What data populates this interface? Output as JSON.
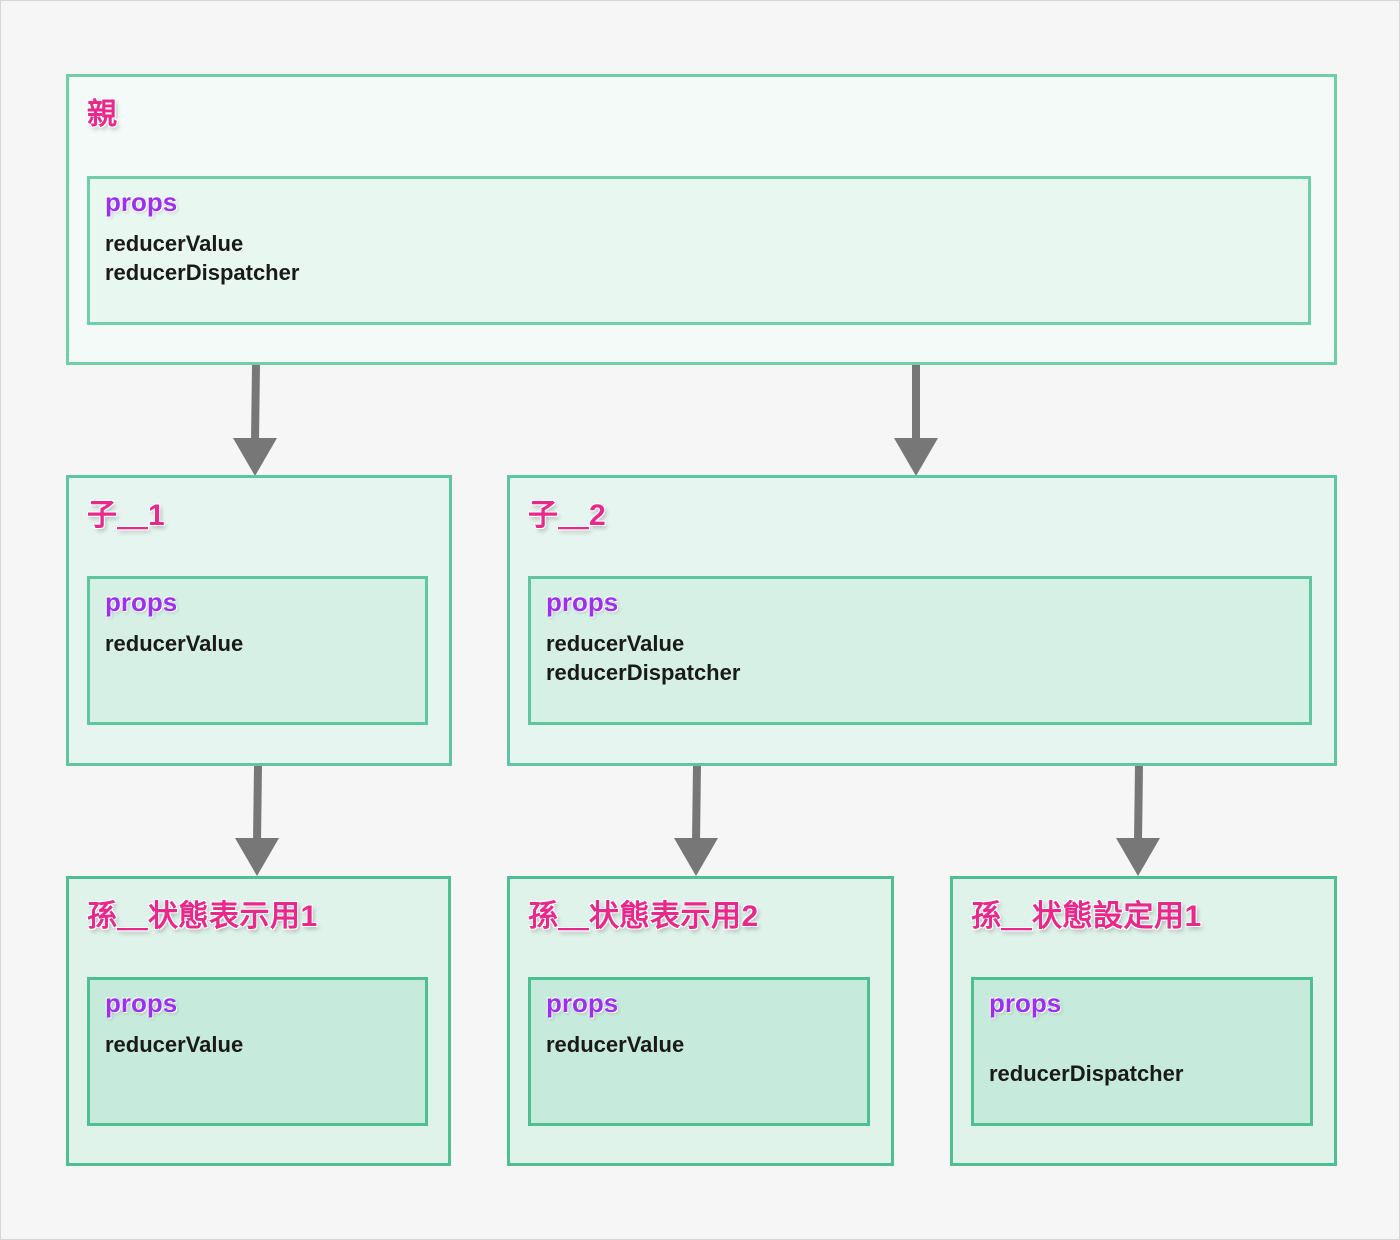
{
  "nodes": {
    "parent": {
      "title": "親",
      "props_label": "props",
      "values": [
        "reducerValue",
        "reducerDispatcher"
      ]
    },
    "child1": {
      "title": "子＿1",
      "props_label": "props",
      "values": [
        "reducerValue"
      ]
    },
    "child2": {
      "title": "子＿2",
      "props_label": "props",
      "values": [
        "reducerValue",
        "reducerDispatcher"
      ]
    },
    "grandchild_display1": {
      "title": "孫＿状態表示用1",
      "props_label": "props",
      "values": [
        "reducerValue"
      ]
    },
    "grandchild_display2": {
      "title": "孫＿状態表示用2",
      "props_label": "props",
      "values": [
        "reducerValue"
      ]
    },
    "grandchild_setter1": {
      "title": "孫＿状態設定用1",
      "props_label": "props",
      "values": [
        "reducerDispatcher"
      ]
    }
  },
  "edges": [
    {
      "from": "parent",
      "to": "child1"
    },
    {
      "from": "parent",
      "to": "child2"
    },
    {
      "from": "child1",
      "to": "grandchild_display1"
    },
    {
      "from": "child2",
      "to": "grandchild_display2"
    },
    {
      "from": "child2",
      "to": "grandchild_setter1"
    }
  ],
  "colors": {
    "title": "#e8288a",
    "props_label": "#9b30f0",
    "border": "#6fcfa8",
    "arrow": "#777777"
  }
}
